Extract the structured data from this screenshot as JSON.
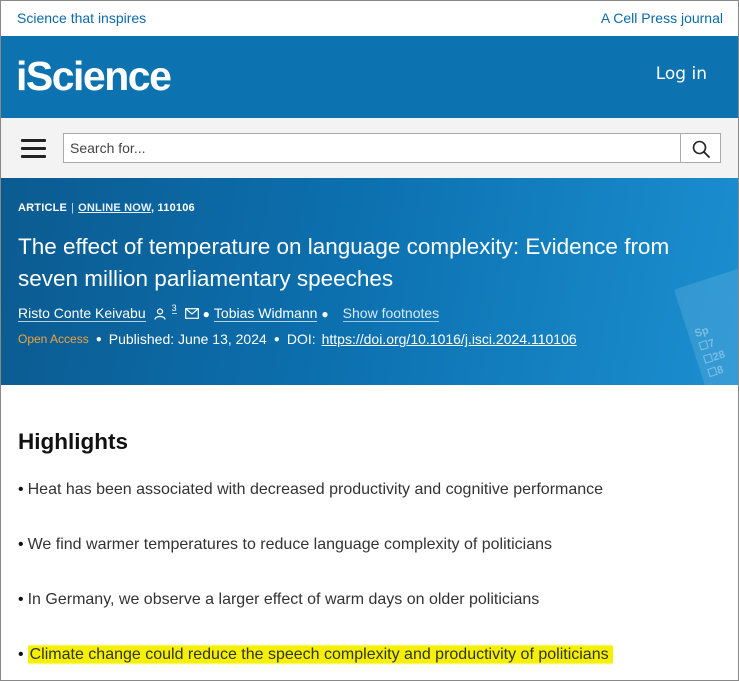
{
  "topbar": {
    "tagline": "Science that inspires",
    "journal_note": "A Cell Press journal"
  },
  "header": {
    "logo": "iScience",
    "login_label": "Log in"
  },
  "search": {
    "placeholder": "Search for..."
  },
  "article": {
    "type": "ARTICLE",
    "status": "ONLINE NOW",
    "number": ", 110106",
    "title": "The effect of temperature on language complexity: Evidence from seven million parliamentary speeches",
    "authors": [
      {
        "name": "Risto Conte Keivabu",
        "affiliation_count": "3"
      },
      {
        "name": "Tobias Widmann"
      }
    ],
    "show_footnotes": "Show footnotes",
    "open_access": "Open Access",
    "published": "Published:  June 13, 2024",
    "doi_label": "DOI:",
    "doi_url": "https://doi.org/10.1016/j.isci.2024.110106"
  },
  "highlights": {
    "title": "Highlights",
    "items": [
      "Heat has been associated with decreased productivity and cognitive performance",
      "We find warmer temperatures to reduce language complexity of politicians",
      "In Germany, we observe a larger effect of warm days on older politicians",
      "Climate change could reduce the speech complexity and productivity of politicians"
    ],
    "highlight_color": "#f4f000"
  },
  "colors": {
    "brand_blue": "#0d72b0",
    "link_blue": "#0a6aa8",
    "open_access_orange": "#f2a33a"
  }
}
